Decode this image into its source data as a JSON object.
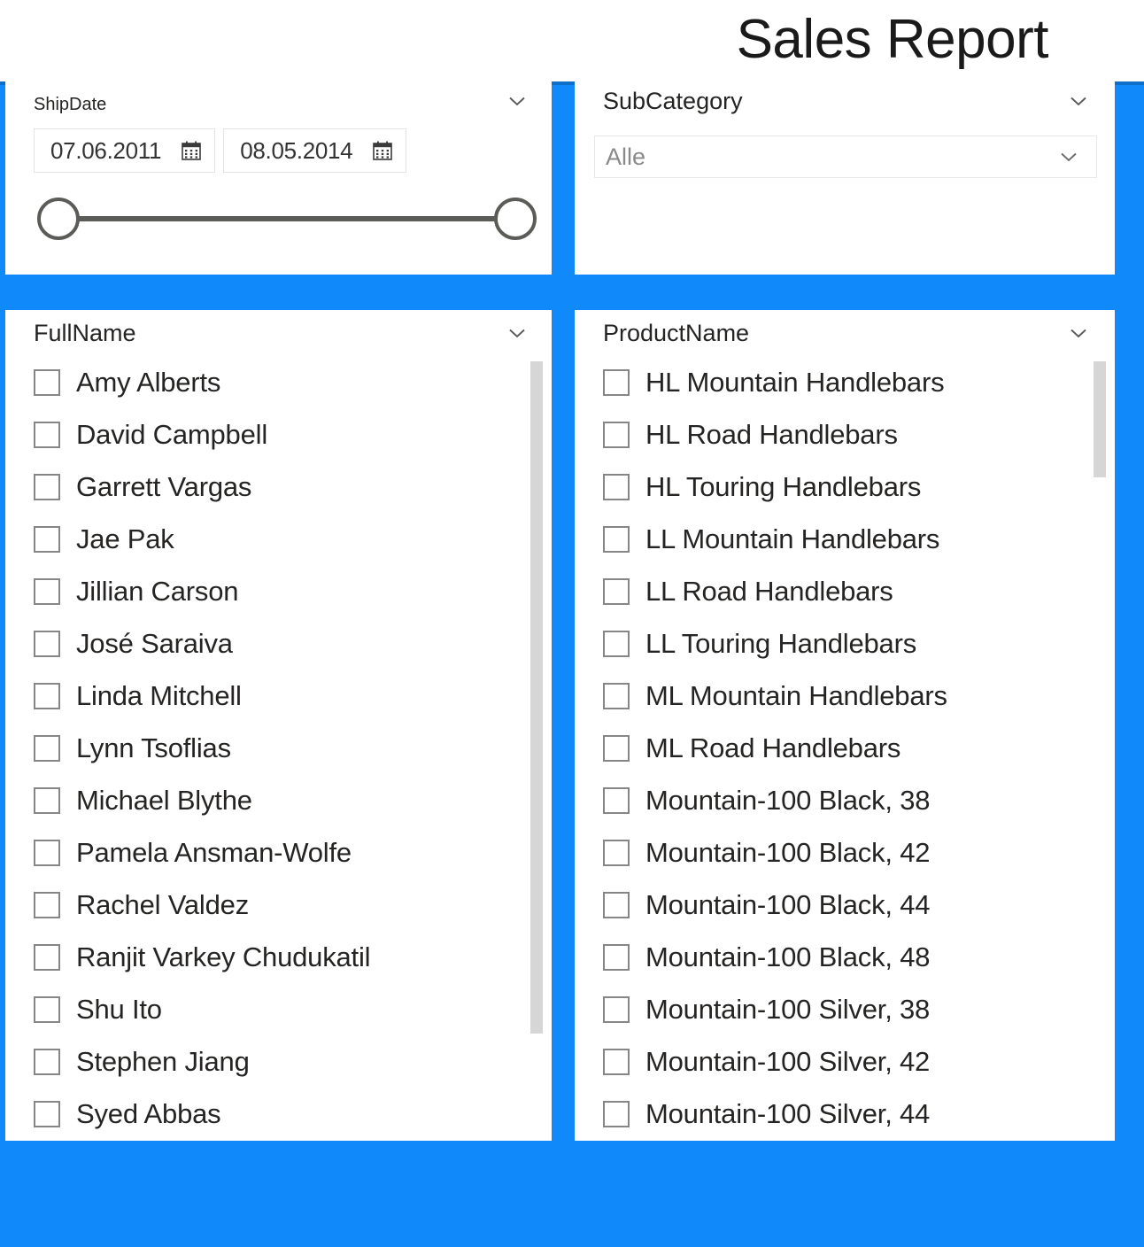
{
  "header": {
    "title": "Sales Report"
  },
  "theme": {
    "accent_blue": "#1089fb",
    "accent_blue_dark": "#0d6fc9",
    "panel_bg": "#ffffff",
    "text": "#252423",
    "muted_text": "#8a8a8a",
    "slider_gray": "#5b5b58",
    "checkbox_border": "#868686",
    "scrollbar_thumb": "#d6d6d6"
  },
  "ship_date": {
    "title": "ShipDate",
    "collapse_icon": "chevron-down-icon",
    "start_date": "07.06.2011",
    "end_date": "08.05.2014",
    "start_calendar_icon": "calendar-icon",
    "end_calendar_icon": "calendar-icon",
    "slider": {
      "left_handle": "slider-handle-left",
      "right_handle": "slider-handle-right"
    }
  },
  "subcategory": {
    "title": "SubCategory",
    "collapse_icon": "chevron-down-icon",
    "selected": "Alle",
    "dropdown_icon": "chevron-down-icon"
  },
  "fullname": {
    "title": "FullName",
    "collapse_icon": "chevron-down-icon",
    "items": [
      {
        "label": "Amy Alberts",
        "checked": false
      },
      {
        "label": "David Campbell",
        "checked": false
      },
      {
        "label": "Garrett Vargas",
        "checked": false
      },
      {
        "label": "Jae Pak",
        "checked": false
      },
      {
        "label": "Jillian Carson",
        "checked": false
      },
      {
        "label": "José Saraiva",
        "checked": false
      },
      {
        "label": "Linda Mitchell",
        "checked": false
      },
      {
        "label": "Lynn Tsoflias",
        "checked": false
      },
      {
        "label": "Michael Blythe",
        "checked": false
      },
      {
        "label": "Pamela Ansman-Wolfe",
        "checked": false
      },
      {
        "label": "Rachel Valdez",
        "checked": false
      },
      {
        "label": "Ranjit Varkey Chudukatil",
        "checked": false
      },
      {
        "label": "Shu Ito",
        "checked": false
      },
      {
        "label": "Stephen Jiang",
        "checked": false
      },
      {
        "label": "Syed Abbas",
        "checked": false
      }
    ],
    "scrollbar": {
      "thumb_top_pct": 0,
      "thumb_height_pct": 87
    }
  },
  "productname": {
    "title": "ProductName",
    "collapse_icon": "chevron-down-icon",
    "items": [
      {
        "label": "HL Mountain Handlebars",
        "checked": false
      },
      {
        "label": "HL Road Handlebars",
        "checked": false
      },
      {
        "label": "HL Touring Handlebars",
        "checked": false
      },
      {
        "label": "LL Mountain Handlebars",
        "checked": false
      },
      {
        "label": "LL Road Handlebars",
        "checked": false
      },
      {
        "label": "LL Touring Handlebars",
        "checked": false
      },
      {
        "label": "ML Mountain Handlebars",
        "checked": false
      },
      {
        "label": "ML Road Handlebars",
        "checked": false
      },
      {
        "label": "Mountain-100 Black, 38",
        "checked": false
      },
      {
        "label": "Mountain-100 Black, 42",
        "checked": false
      },
      {
        "label": "Mountain-100 Black, 44",
        "checked": false
      },
      {
        "label": "Mountain-100 Black, 48",
        "checked": false
      },
      {
        "label": "Mountain-100 Silver, 38",
        "checked": false
      },
      {
        "label": "Mountain-100 Silver, 42",
        "checked": false
      },
      {
        "label": "Mountain-100 Silver, 44",
        "checked": false
      }
    ],
    "scrollbar": {
      "thumb_top_pct": 0,
      "thumb_height_pct": 15
    }
  }
}
